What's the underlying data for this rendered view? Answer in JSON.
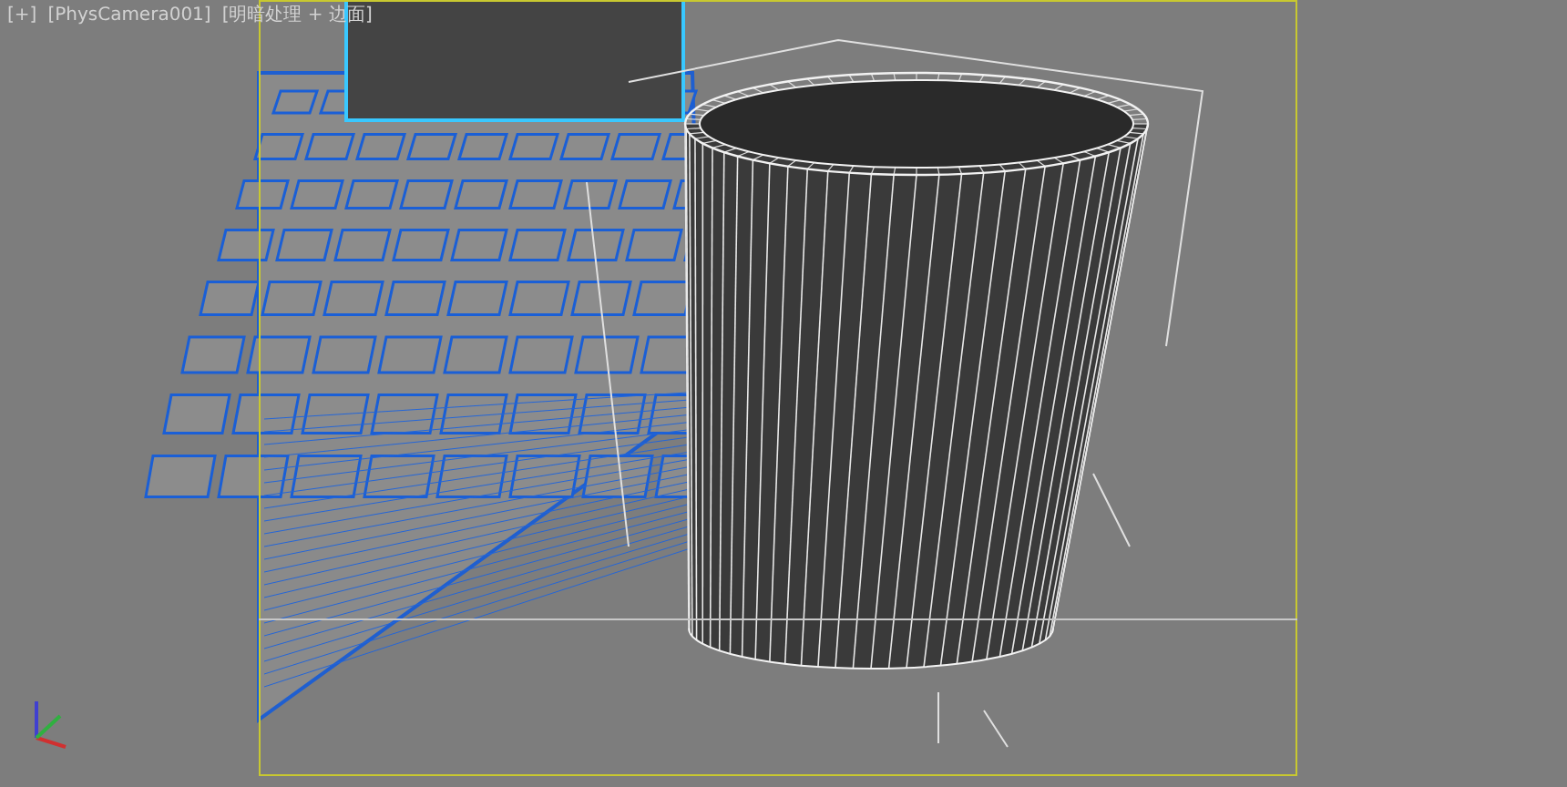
{
  "viewport": {
    "labels": [
      {
        "text": "[+]"
      },
      {
        "text": "[PhysCamera001]"
      },
      {
        "text": "[明暗处理 + 边面]"
      }
    ]
  }
}
